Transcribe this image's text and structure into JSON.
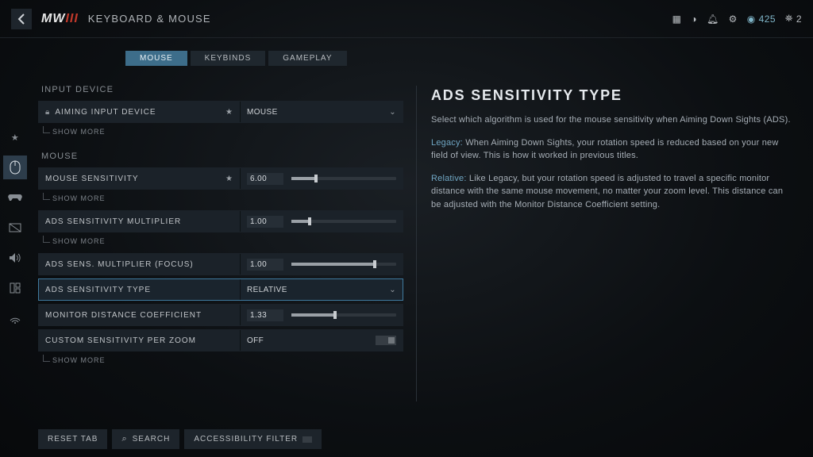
{
  "header": {
    "logo_main": "MW",
    "logo_accent": "III",
    "crumb": "KEYBOARD & MOUSE",
    "credits": "425",
    "party": "2"
  },
  "tabs": [
    "MOUSE",
    "KEYBINDS",
    "GAMEPLAY"
  ],
  "tabs_active": 0,
  "sections": {
    "input_device": {
      "title": "INPUT DEVICE",
      "rows": {
        "aiming_input": {
          "label": "AIMING INPUT DEVICE",
          "value": "MOUSE"
        }
      },
      "show_more": "SHOW MORE"
    },
    "mouse": {
      "title": "MOUSE",
      "rows": {
        "sensitivity": {
          "label": "MOUSE SENSITIVITY",
          "value": "6.00",
          "fill": 22
        },
        "ads_mult": {
          "label": "ADS SENSITIVITY MULTIPLIER",
          "value": "1.00",
          "fill": 16
        },
        "ads_focus": {
          "label": "ADS SENS. MULTIPLIER (FOCUS)",
          "value": "1.00",
          "fill": 78
        },
        "ads_type": {
          "label": "ADS SENSITIVITY TYPE",
          "value": "RELATIVE"
        },
        "monitor": {
          "label": "MONITOR DISTANCE COEFFICIENT",
          "value": "1.33",
          "fill": 40
        },
        "custom_zoom": {
          "label": "CUSTOM SENSITIVITY PER ZOOM",
          "value": "OFF"
        }
      },
      "show_more": "SHOW MORE"
    }
  },
  "bottom": {
    "reset": "RESET TAB",
    "search": "SEARCH",
    "access": "ACCESSIBILITY FILTER"
  },
  "info": {
    "title": "ADS SENSITIVITY TYPE",
    "intro": "Select which algorithm is used for the mouse sensitivity when Aiming Down Sights (ADS).",
    "legacy_term": "Legacy:",
    "legacy_body": "When Aiming Down Sights, your rotation speed is reduced based on your new field of view. This is how it worked in previous titles.",
    "relative_term": "Relative:",
    "relative_body": "Like Legacy, but your rotation speed is adjusted to travel a specific monitor distance with the same mouse movement, no matter your zoom level. This distance can be adjusted with the Monitor Distance Coefficient setting."
  }
}
